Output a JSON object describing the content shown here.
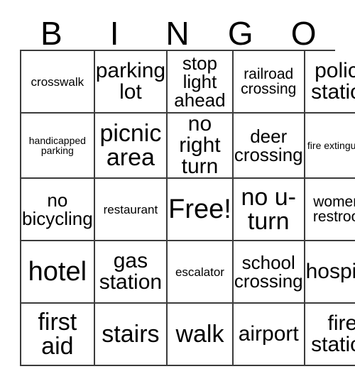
{
  "header": {
    "letters": [
      "B",
      "I",
      "N",
      "G",
      "O"
    ]
  },
  "grid": {
    "rows": [
      [
        {
          "label": "crosswalk",
          "size": "sm",
          "wrap": "nowrap"
        },
        {
          "label": "parking lot",
          "size": "xl",
          "wrap": "wrap"
        },
        {
          "label": "stop light ahead",
          "size": "lg",
          "wrap": "wrap"
        },
        {
          "label": "railroad crossing",
          "size": "md",
          "wrap": "wrap"
        },
        {
          "label": "police station",
          "size": "xl",
          "wrap": "wrap"
        }
      ],
      [
        {
          "label": "handicapped parking",
          "size": "xs",
          "wrap": "wrap"
        },
        {
          "label": "picnic area",
          "size": "xxl",
          "wrap": "wrap"
        },
        {
          "label": "no right turn",
          "size": "xl",
          "wrap": "wrap"
        },
        {
          "label": "deer crossing",
          "size": "lg",
          "wrap": "wrap"
        },
        {
          "label": "fire extinguisher",
          "size": "xs",
          "wrap": "wrap"
        }
      ],
      [
        {
          "label": "no bicycling",
          "size": "lg",
          "wrap": "wrap"
        },
        {
          "label": "restaurant",
          "size": "sm",
          "wrap": "nowrap"
        },
        {
          "label": "Free!",
          "size": "huge",
          "wrap": "nowrap"
        },
        {
          "label": "no u-turn",
          "size": "xxl",
          "wrap": "wrap"
        },
        {
          "label": "women's restroom",
          "size": "md",
          "wrap": "wrap"
        }
      ],
      [
        {
          "label": "hotel",
          "size": "huge",
          "wrap": "nowrap"
        },
        {
          "label": "gas station",
          "size": "xl",
          "wrap": "wrap"
        },
        {
          "label": "escalator",
          "size": "sm",
          "wrap": "nowrap"
        },
        {
          "label": "school crossing",
          "size": "lg",
          "wrap": "wrap"
        },
        {
          "label": "hospital",
          "size": "xl",
          "wrap": "nowrap"
        }
      ],
      [
        {
          "label": "first aid",
          "size": "xxl",
          "wrap": "wrap"
        },
        {
          "label": "stairs",
          "size": "xxl",
          "wrap": "nowrap"
        },
        {
          "label": "walk",
          "size": "xxl",
          "wrap": "nowrap"
        },
        {
          "label": "airport",
          "size": "xl",
          "wrap": "nowrap"
        },
        {
          "label": "fire station",
          "size": "xl",
          "wrap": "wrap"
        }
      ]
    ]
  },
  "colors": {
    "border": "#3b3b3b",
    "text": "#000000",
    "background": "#ffffff"
  }
}
